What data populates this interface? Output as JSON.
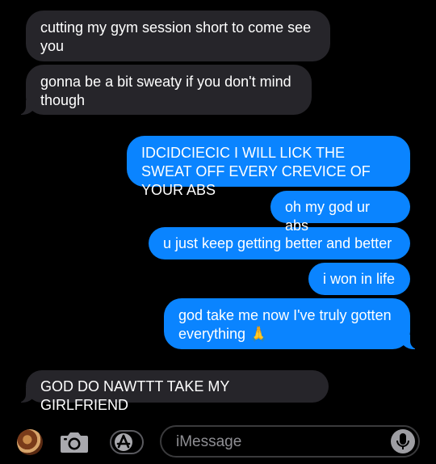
{
  "messages": [
    {
      "direction": "received",
      "text": "cutting my gym session short to come see you"
    },
    {
      "direction": "received",
      "text": "gonna be a bit  sweaty if you don't mind though"
    },
    {
      "direction": "sent",
      "text": "IDCIDCIECIC I WILL LICK THE SWEAT OFF EVERY CREVICE OF YOUR ABS"
    },
    {
      "direction": "sent",
      "text": "oh my god ur abs"
    },
    {
      "direction": "sent",
      "text": "u just keep getting better and better"
    },
    {
      "direction": "sent",
      "text": "i won in life"
    },
    {
      "direction": "sent",
      "text": "god take me now I've truly gotten everything 🙏"
    },
    {
      "direction": "received",
      "text": "GOD DO NAWTTT TAKE MY GIRLFRIEND"
    }
  ],
  "input": {
    "placeholder": "iMessage"
  },
  "icons": {
    "avatar": "contact-avatar",
    "camera": "camera-icon",
    "appstore": "app-store-icon",
    "mic": "microphone-icon"
  },
  "colors": {
    "background": "#000000",
    "received_bubble": "#26252a",
    "sent_bubble": "#0a84ff",
    "placeholder": "#8e8e93"
  }
}
